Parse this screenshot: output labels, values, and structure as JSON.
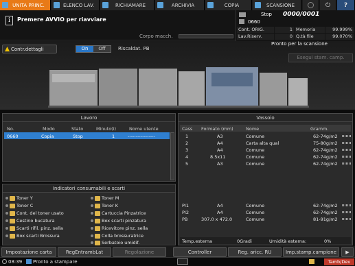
{
  "tabs": [
    {
      "label": "UNITA PRINC.",
      "icon": "home-icon"
    },
    {
      "label": "ELENCO LAV.",
      "icon": "job-list-icon"
    },
    {
      "label": "RICHIAMARE",
      "icon": "recall-icon"
    },
    {
      "label": "ARCHIVIA",
      "icon": "archive-icon"
    },
    {
      "label": "COPIA",
      "icon": "copy-icon"
    },
    {
      "label": "SCANSIONE",
      "icon": "scan-icon"
    }
  ],
  "message": "Premere AVVIO per riavviare",
  "corpo": "Corpo macch.",
  "status": {
    "stop_label": "Stop",
    "counter": "0000/0001",
    "job_number": "0660",
    "cont_orig_label": "Cont. ORIG.",
    "cont_orig_value": "1",
    "memoria_label": "Memoria",
    "memoria_value": "99.999%",
    "lav_riserv_label": "Lav.Riserv.",
    "lav_riserv_value": "0",
    "qta_file_label": "Q.tà file",
    "qta_file_value": "99.070%"
  },
  "contr_label": "Contr.dettagli",
  "on_label": "On",
  "off_label": "Off",
  "riscaldat": "Riscaldat. PB",
  "pronto": "Pronto per la scansione",
  "esegui": "Esegui stam. camp.",
  "lavoro": {
    "title": "Lavoro",
    "headers": [
      "No.",
      "Modo",
      "Stato",
      "Minuto(i)",
      "Nome utente"
    ],
    "rows": [
      {
        "no": "0660",
        "modo": "Copia",
        "stato": "Stop",
        "min": "1",
        "user": "-----------------"
      }
    ]
  },
  "consumabili": {
    "title": "Indicatori consumabili e scarti",
    "left": [
      "Toner Y",
      "Toner C",
      "Cont. del toner usato",
      "Cestino bucatura",
      "Scarti rifil. pinz. sella",
      "Box scarti Brossura"
    ],
    "right": [
      "Toner M",
      "Toner K",
      "Cartuccia Pinzatrice",
      "Box scarti pinzatura",
      "Ricevitore pinz. sella",
      "Colla brossuratrice",
      "Serbatoio umidif."
    ]
  },
  "vassoio": {
    "title": "Vassoio",
    "headers": [
      "Cass",
      "Formato (mm)",
      "Nome",
      "Gramm."
    ],
    "rows": [
      {
        "cass": "1",
        "fmt": "A3",
        "nome": "Comune",
        "gram": "62-74g/m2"
      },
      {
        "cass": "2",
        "fmt": "A4",
        "nome": "Carta alta qual",
        "gram": "75-80g/m2"
      },
      {
        "cass": "3",
        "fmt": "A4",
        "nome": "Comune",
        "gram": "62-74g/m2"
      },
      {
        "cass": "4",
        "fmt": "8.5x11",
        "nome": "Comune",
        "gram": "62-74g/m2"
      },
      {
        "cass": "5",
        "fmt": "A3",
        "nome": "Comune",
        "gram": "62-74g/m2"
      },
      {
        "cass": "PI1",
        "fmt": "A4",
        "nome": "Comune",
        "gram": "62-74g/m2"
      },
      {
        "cass": "PI2",
        "fmt": "A4",
        "nome": "Comune",
        "gram": "62-74g/m2"
      },
      {
        "cass": "PB",
        "fmt": "307.0 x 472.0",
        "nome": "Comune",
        "gram": "81-91g/m2"
      }
    ],
    "temp_label": "Temp.esterna",
    "temp_value": "0Gradi",
    "umid_label": "Umidità esterna:",
    "umid_value": "0%"
  },
  "bottom": [
    "Impostazione carta",
    "RegEntrambLat",
    "Regolazione",
    "Controller",
    "Reg. aricc. RU",
    "Imp.stamp.campione"
  ],
  "statusbar": {
    "time": "08:39",
    "status": "Pronto a stampare",
    "badge": "Tamb/Dev"
  }
}
